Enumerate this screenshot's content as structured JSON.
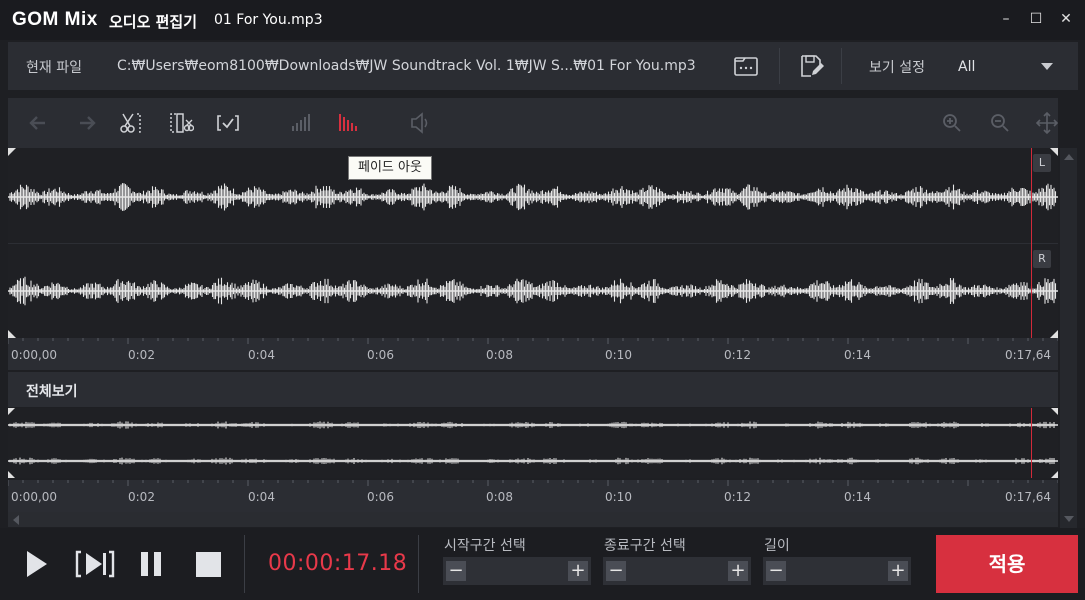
{
  "window": {
    "logo": "GOM Mix",
    "app_name": "오디오 편집기",
    "file_name": "01 For You.mp3",
    "minimize_glyph": "–",
    "maximize_glyph": "☐",
    "close_glyph": "✕"
  },
  "file_bar": {
    "current_file_label": "현재 파일",
    "path": "C:₩Users₩eom8100₩Downloads₩JW Soundtrack Vol. 1₩JW S...₩01 For You.mp3",
    "view_settings_label": "보기 설정",
    "view_settings_value": "All"
  },
  "toolbar": {
    "icons": [
      "undo-icon",
      "redo-icon",
      "cut-icon",
      "trim-icon",
      "select-icon",
      "fade-in-icon",
      "fade-out-icon",
      "volume-icon",
      "zoom-in-icon",
      "zoom-out-icon",
      "fit-icon"
    ]
  },
  "tooltip": "페이드 아웃",
  "channels": {
    "left": "L",
    "right": "R"
  },
  "timeline": {
    "ticks": [
      "0:00,00",
      "0:02",
      "0:04",
      "0:06",
      "0:08",
      "0:10",
      "0:12",
      "0:14",
      "0:17,64"
    ]
  },
  "overview": {
    "label": "전체보기"
  },
  "playback": {
    "current_time": "00:00:17.18",
    "start_label": "시작구간 선택",
    "end_label": "종료구간 선택",
    "length_label": "길이",
    "minus": "−",
    "plus": "+",
    "apply_label": "적용"
  },
  "colors": {
    "accent": "#d7303f",
    "playhead": "#d22a3a",
    "waveform": "#e6e6e6",
    "background": "#1e1f23"
  }
}
